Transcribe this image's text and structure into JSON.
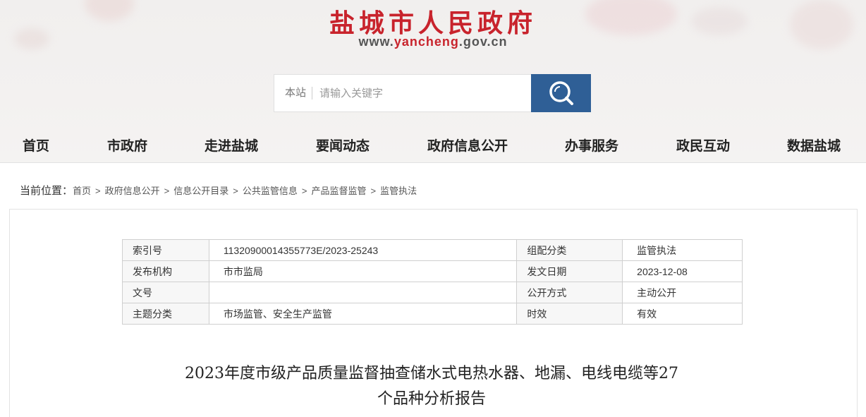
{
  "header": {
    "title": "盐城市人民政府",
    "url_prefix": "www.",
    "url_accent": "yancheng",
    "url_suffix": ".gov.cn",
    "brand_color": "#c8232c"
  },
  "search": {
    "scope": "本站",
    "placeholder": "请输入关键字",
    "button_icon": "search-icon",
    "button_color": "#2f5f96"
  },
  "nav": {
    "items": [
      "首页",
      "市政府",
      "走进盐城",
      "要闻动态",
      "政府信息公开",
      "办事服务",
      "政民互动",
      "数据盐城"
    ]
  },
  "breadcrumb": {
    "label": "当前位置：",
    "items": [
      "首页",
      "政府信息公开",
      "信息公开目录",
      "公共监管信息",
      "产品监督监管",
      "监管执法"
    ],
    "separator": ">"
  },
  "meta": {
    "rows": [
      {
        "k1": "索引号",
        "v1": "11320900014355773E/2023-25243",
        "k2": "组配分类",
        "v2": "监管执法"
      },
      {
        "k1": "发布机构",
        "v1": "市市监局",
        "k2": "发文日期",
        "v2": "2023-12-08"
      },
      {
        "k1": "文号",
        "v1": "",
        "k2": "公开方式",
        "v2": "主动公开"
      },
      {
        "k1": "主题分类",
        "v1": "市场监管、安全生产监管",
        "k2": "时效",
        "v2": "有效"
      }
    ]
  },
  "article": {
    "title_line1": "2023年度市级产品质量监督抽查储水式电热水器、地漏、电线电缆等27",
    "title_line2": "个品种分析报告"
  }
}
